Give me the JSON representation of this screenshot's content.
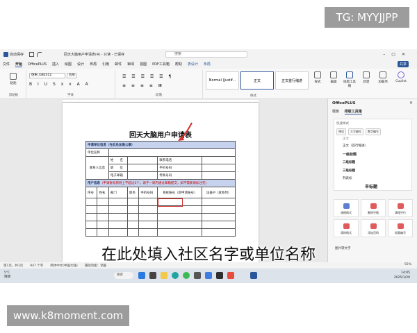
{
  "watermarks": {
    "top": "TG: MYYJJPP",
    "bottom": "www.k8moment.com"
  },
  "window": {
    "autosave": "自动保存",
    "title": "回天大脑用户申请表(4) - 只读 - 已保存",
    "search_placeholder": "搜索"
  },
  "menu": {
    "items": [
      "文件",
      "开始",
      "OfficePLUS",
      "插入",
      "绘图",
      "设计",
      "布局",
      "引用",
      "邮件",
      "审阅",
      "视图",
      "PDF工具箱",
      "帮助",
      "表设计",
      "布局"
    ],
    "active_index": 1,
    "share": "共享"
  },
  "ribbon": {
    "clipboard_label": "剪贴板",
    "paste": "粘贴",
    "font_name": "仿宋_GB2312",
    "font_size": "五号",
    "font_label": "字体",
    "paragraph_label": "段落",
    "styles": [
      "Normal (Justif...",
      "正文",
      "正文首行缩进"
    ],
    "styles_label": "样式",
    "buttons": [
      "样式",
      "编辑",
      "排版工具箱",
      "新建",
      "加载项",
      "Copilot"
    ]
  },
  "document": {
    "title": "回天大脑用户申请表",
    "section1": "申请单位信息（在此处加盖公章）",
    "unit_name_label": "单位名称",
    "contact_label": "联系人信息",
    "name_label": "姓　　名",
    "office_phone": "联系电话",
    "position_label": "职　　位",
    "mobile_label": "手机号码",
    "email_label": "电子邮箱",
    "fax_label": "传真号码",
    "section2": "用户信息",
    "section2_note": "（申请账号原则上不超过5个，请于一周内通过邮箱提交，如不需要请标注无）",
    "columns": [
      "序号",
      "姓名",
      "部门",
      "职务",
      "手机号码",
      "系统账号（即申请账号）",
      "设备IP（就系列）"
    ]
  },
  "caption": "在此处填入社区名字或单位名称",
  "pane": {
    "title": "OfficePLUS",
    "tabs": [
      "模板",
      "排版工具箱"
    ],
    "active_tab": 1,
    "section": "快速样式",
    "chips": [
      "预设",
      "大写编号",
      "数字编号"
    ],
    "styles": [
      "正文",
      "正文（首行缩进）",
      "一级标题",
      "二级标题",
      "三级标题",
      "列表标",
      "丰标题"
    ],
    "tools": [
      "调格格式",
      "删除空格",
      "清理空行",
      "清除格式",
      "添加页码",
      "标题编号"
    ],
    "image_to_text": "图片转文字"
  },
  "status": {
    "page": "第1页，共1页",
    "words": "947 个字",
    "lang": "简体中文(中国大陆)",
    "accessibility": "辅助功能：调查",
    "zoom": "92%"
  },
  "taskbar": {
    "temperature": "5°C",
    "weather": "晴朗",
    "search": "搜索",
    "time": "14:05",
    "date": "2025/1/20"
  },
  "colors": {
    "word_blue": "#2b579a",
    "table_header": "#c7d3ee",
    "accent_red": "#d0312d"
  }
}
